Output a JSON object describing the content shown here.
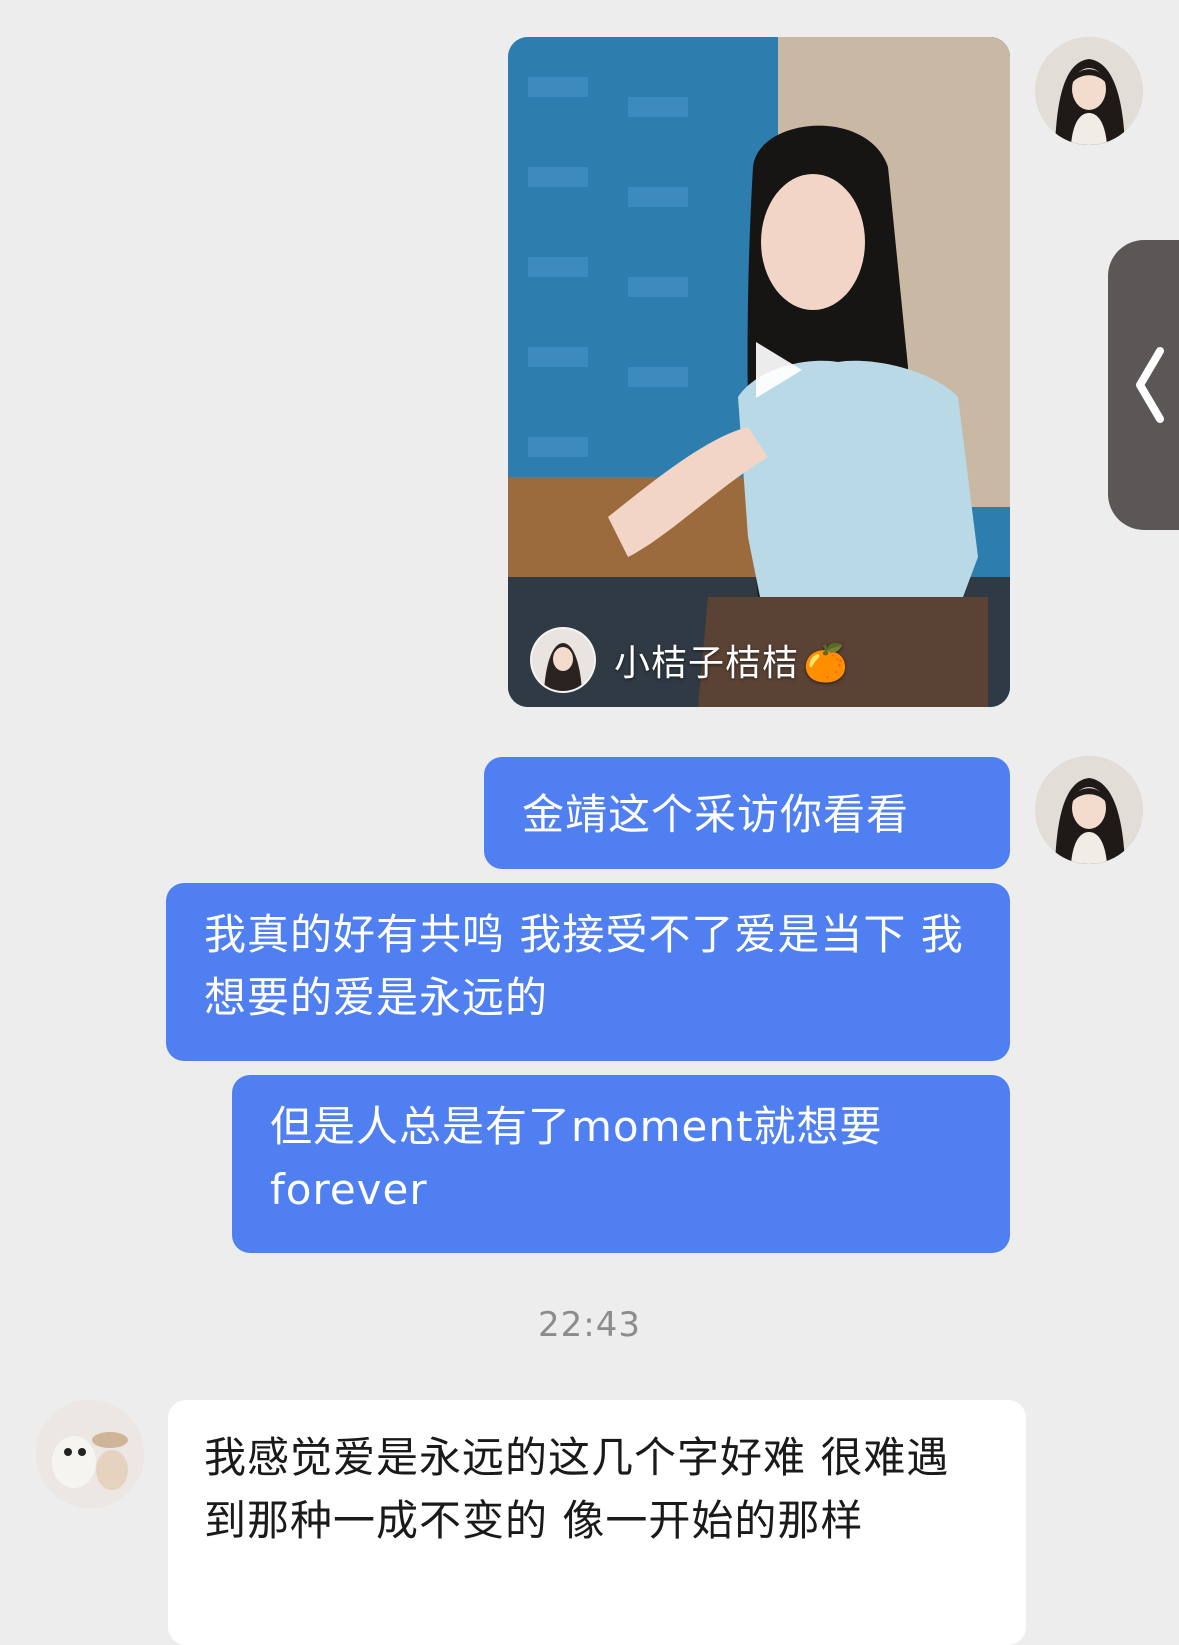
{
  "video_card": {
    "author_name": "小桔子桔桔",
    "author_emoji": "🍊",
    "play_icon": "play-icon"
  },
  "messages": [
    {
      "side": "right",
      "text": "金靖这个采访你看看"
    },
    {
      "side": "right",
      "text": "我真的好有共鸣 我接受不了爱是当下 我想要的爱是永远的"
    },
    {
      "side": "right",
      "text": "但是人总是有了moment就想要forever"
    },
    {
      "side": "left",
      "text": "我感觉爱是永远的这几个字好难 很难遇到那种一成不变的  像一开始的那样"
    }
  ],
  "timestamp": "22:43",
  "side_handle": {
    "icon": "chevron-left-icon"
  },
  "colors": {
    "background": "#ededed",
    "my_bubble": "#4f7ff1",
    "other_bubble": "#ffffff"
  }
}
